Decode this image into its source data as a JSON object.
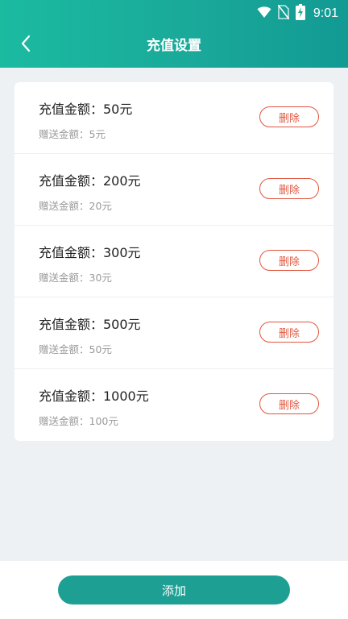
{
  "status_bar": {
    "time": "9:01",
    "icons": [
      "wifi-icon",
      "no-sim-icon",
      "battery-charging-icon"
    ]
  },
  "header": {
    "title": "充值设置",
    "back_icon": "chevron-left-icon"
  },
  "recharge_list": [
    {
      "amount": "充值金额：50元",
      "gift": "赠送金额：5元",
      "delete_label": "删除"
    },
    {
      "amount": "充值金额：200元",
      "gift": "赠送金额：20元",
      "delete_label": "删除"
    },
    {
      "amount": "充值金额：300元",
      "gift": "赠送金额：30元",
      "delete_label": "删除"
    },
    {
      "amount": "充值金额：500元",
      "gift": "赠送金额：50元",
      "delete_label": "删除"
    },
    {
      "amount": "充值金额：1000元",
      "gift": "赠送金额：100元",
      "delete_label": "删除"
    }
  ],
  "footer": {
    "add_label": "添加"
  },
  "colors": {
    "header_gradient_start": "#1bbba0",
    "header_gradient_end": "#129a93",
    "accent": "#1e9f94",
    "delete": "#e0573f",
    "background": "#edf1f4"
  }
}
